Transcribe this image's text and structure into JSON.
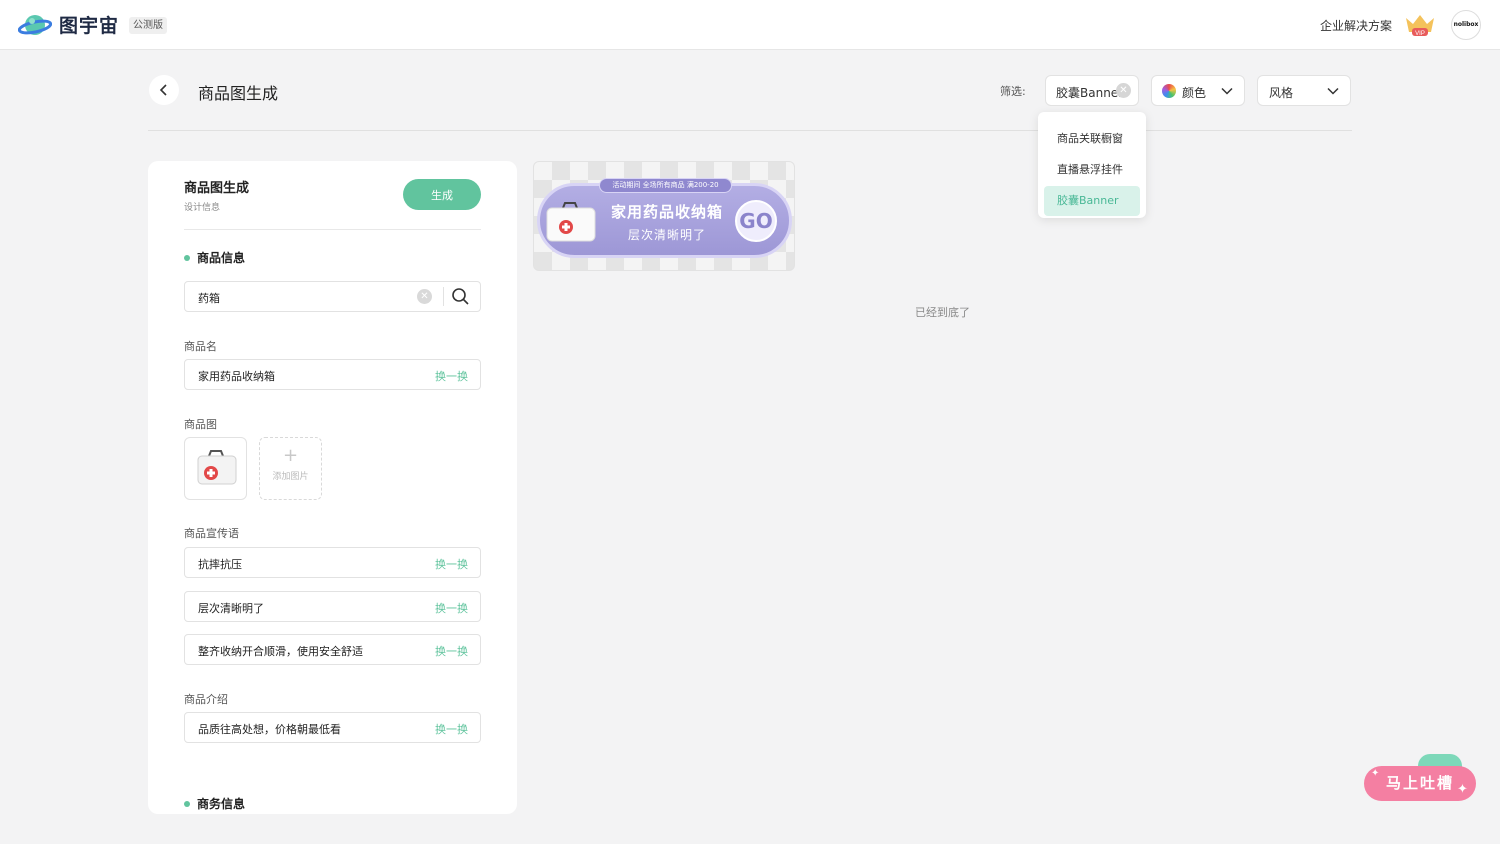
{
  "header": {
    "logo_text": "图宇宙",
    "badge": "公测版",
    "enterprise_link": "企业解决方案",
    "vip_label": "VIP",
    "avatar_text": "nolibox"
  },
  "page": {
    "title": "商品图生成",
    "filter_label": "筛选:",
    "filters": {
      "type_value": "胶囊Banner",
      "color_label": "颜色",
      "style_label": "风格"
    },
    "dropdown": {
      "items": [
        {
          "label": "商品关联橱窗"
        },
        {
          "label": "直播悬浮挂件"
        },
        {
          "label": "胶囊Banner",
          "active": true
        }
      ]
    }
  },
  "panel": {
    "title": "商品图生成",
    "subtitle": "设计信息",
    "generate_label": "生成",
    "product_info_heading": "商品信息",
    "search_value": "药箱",
    "name_label": "商品名",
    "name_value": "家用药品收纳箱",
    "swap_label": "换一换",
    "image_label": "商品图",
    "add_image_label": "添加图片",
    "slogan_label": "商品宣传语",
    "slogans": [
      "抗摔抗压",
      "层次清晰明了",
      "整齐收纳开合顺滑，使用安全舒适"
    ],
    "intro_label": "商品介绍",
    "intro_value": "品质往高处想，价格朝最低看",
    "business_heading": "商务信息"
  },
  "banner": {
    "promo_tag": "活动期间 全场所有商品 满200-20",
    "title": "家用药品收纳箱",
    "subtitle": "层次清晰明了",
    "go_label": "GO"
  },
  "end_of_list": "已经到底了",
  "feedback_label": "马上吐槽",
  "colors": {
    "accent_green": "#61c49e",
    "banner_purple": "#9d97d6",
    "feedback_pink": "#f47fa2"
  }
}
